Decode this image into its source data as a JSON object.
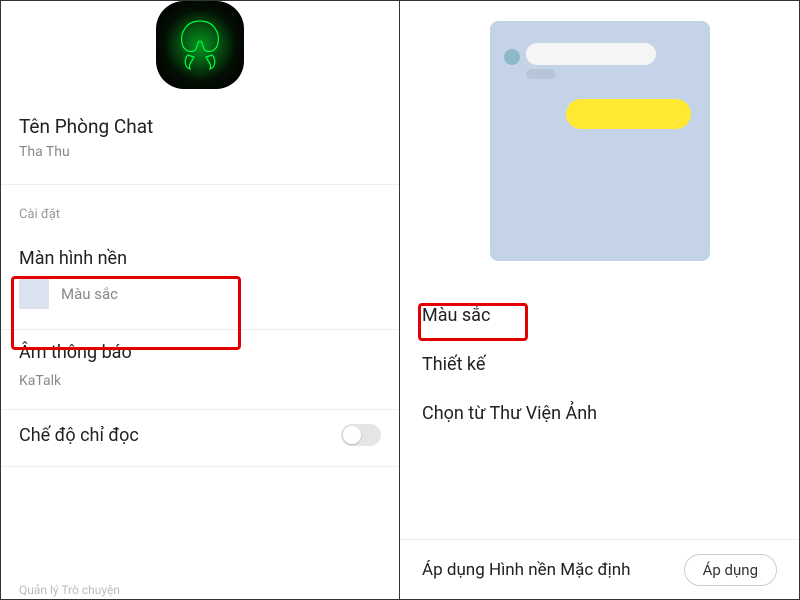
{
  "left": {
    "roomNameLabel": "Tên Phòng Chat",
    "roomNameValue": "Tha Thu",
    "settingsHeader": "Cài đặt",
    "wallpaper": {
      "title": "Màn hình nền",
      "value": "Màu sắc"
    },
    "notificationSound": {
      "title": "Âm thông báo",
      "value": "KaTalk"
    },
    "readOnly": {
      "title": "Chế độ chỉ đọc"
    },
    "footer": "Quản lý Trò chuyện"
  },
  "right": {
    "options": {
      "color": "Màu sắc",
      "design": "Thiết kế",
      "gallery": "Chọn từ Thư Viện Ảnh"
    },
    "defaultLabel": "Áp dụng Hình nền Mặc định",
    "applyButton": "Áp dụng"
  }
}
